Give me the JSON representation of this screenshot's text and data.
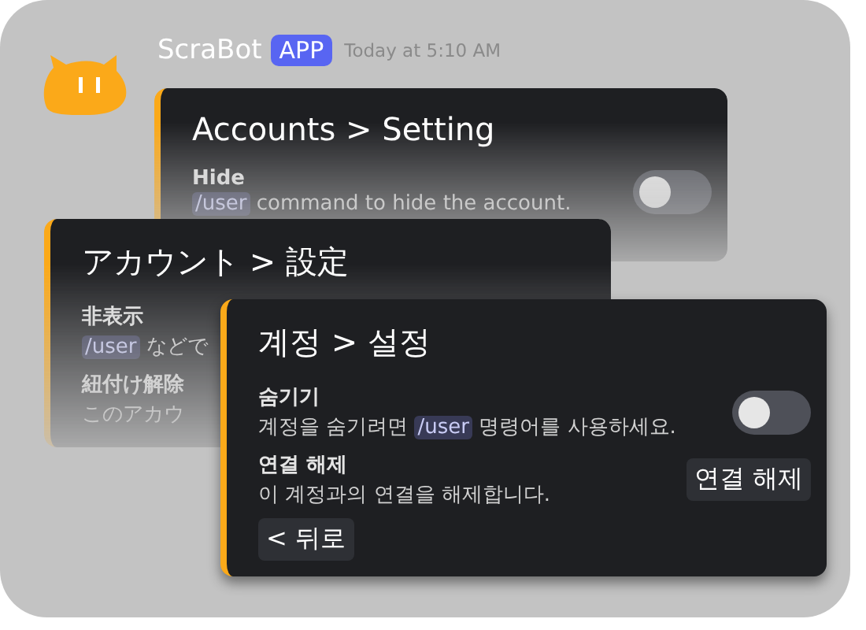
{
  "header": {
    "name": "ScraBot",
    "badge": "APP",
    "time": "Today at 5:10 AM"
  },
  "cards": [
    {
      "title": "Accounts > Setting",
      "faded": true,
      "rows": [
        {
          "label": "Hide",
          "description": [
            {
              "kind": "code",
              "text": "/user"
            },
            {
              "kind": "plain",
              "text": " command to hide the account."
            }
          ],
          "control": {
            "kind": "toggle",
            "on": false
          }
        }
      ]
    },
    {
      "title": "アカウント > 設定",
      "faded": true,
      "rows": [
        {
          "label": "非表示",
          "description": [
            {
              "kind": "code",
              "text": "/user"
            },
            {
              "kind": "plain",
              "text": " などで"
            }
          ]
        },
        {
          "label": "紐付け解除",
          "description": [
            {
              "kind": "plain",
              "text": "このアカウ"
            }
          ]
        }
      ]
    },
    {
      "title": "계정 > 설정",
      "faded": false,
      "rows": [
        {
          "label": "숨기기",
          "description": [
            {
              "kind": "plain",
              "text": "계정을 숨기려면 "
            },
            {
              "kind": "code",
              "text": "/user"
            },
            {
              "kind": "plain",
              "text": " 명령어를 사용하세요."
            }
          ],
          "control": {
            "kind": "toggle",
            "on": false
          }
        },
        {
          "label": "연결 해제",
          "description": [
            {
              "kind": "plain",
              "text": "이 계정과의 연결을 해제합니다."
            }
          ],
          "control": {
            "kind": "button",
            "label": "연결 해제"
          }
        }
      ],
      "back_button": "< 뒤로"
    }
  ]
}
